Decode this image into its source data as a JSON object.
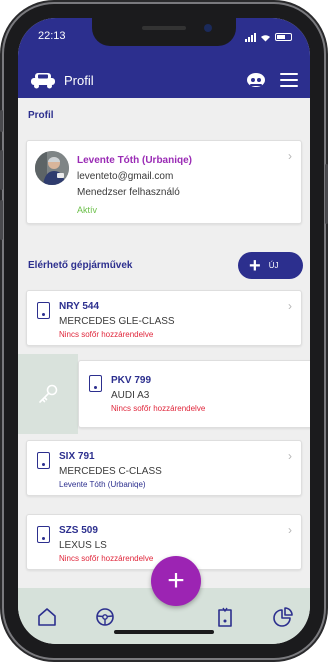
{
  "status_bar": {
    "time": "22:13"
  },
  "header": {
    "title": "Profil"
  },
  "profile_section": {
    "label": "Profil",
    "name": "Levente Tóth (Urbaniqe)",
    "email": "leventeto@gmail.com",
    "role": "Menedzser felhasználó",
    "status": "Aktív"
  },
  "vehicles_section": {
    "label": "Elérhető gépjárművek",
    "new_button_label": "ÚJ",
    "vehicles": [
      {
        "plate": "NRY 544",
        "model": "MERCEDES GLE-CLASS",
        "driver": "Nincs sofőr hozzárendelve"
      },
      {
        "plate": "PKV 799",
        "model": "AUDI A3",
        "driver": "Nincs sofőr hozzárendelve"
      },
      {
        "plate": "SIX 791",
        "model": "MERCEDES C-CLASS",
        "driver": "Levente Tóth (Urbaniqe)"
      },
      {
        "plate": "SZS 509",
        "model": "LEXUS LS",
        "driver": "Nincs sofőr hozzárendelve"
      }
    ]
  },
  "icons": {
    "header_left": "car-icon",
    "header_right": [
      "profile-icon",
      "menu-icon"
    ],
    "swipe_action": "key-icon",
    "bottom_nav": [
      "home-icon",
      "steering-wheel-icon",
      "add-icon",
      "document-icon",
      "pie-chart-icon"
    ]
  },
  "colors": {
    "primary": "#2c2f8e",
    "accent": "#9c24b3",
    "active_status": "#6cc04a",
    "warning": "#e0263b",
    "bottom_nav_bg": "#d6e1da"
  }
}
